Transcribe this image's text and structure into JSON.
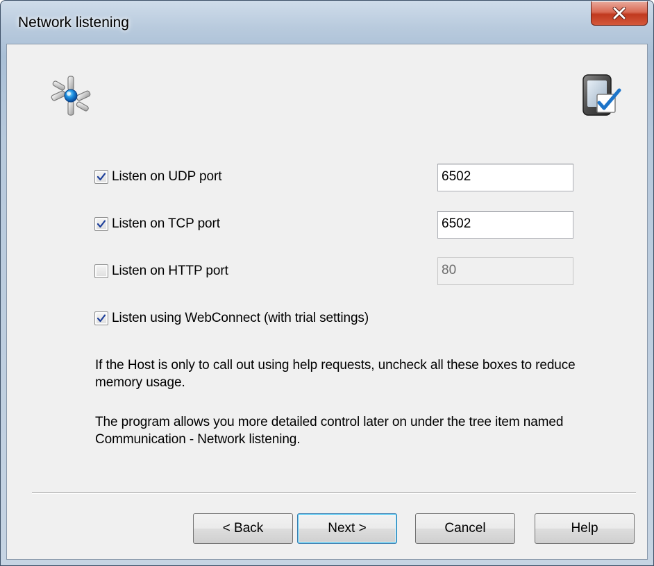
{
  "window": {
    "title": "Network listening",
    "close_glyph": "X"
  },
  "icons": {
    "header_left": "network-hub-icon",
    "header_right": "device-checkmark-icon",
    "close": "close-icon",
    "check": "checkmark-icon"
  },
  "colors": {
    "accent": "#1c74c9",
    "close_button": "#c7432a"
  },
  "options": [
    {
      "label": "Listen on UDP port",
      "checked": true,
      "port": "6502",
      "port_enabled": true
    },
    {
      "label": "Listen on TCP port",
      "checked": true,
      "port": "6502",
      "port_enabled": true
    },
    {
      "label": "Listen on HTTP port",
      "checked": false,
      "port": "80",
      "port_enabled": false
    },
    {
      "label": "Listen using WebConnect (with trial settings)",
      "checked": true
    }
  ],
  "info": {
    "paragraph1": "If the Host is only to call out using help requests, uncheck all these boxes to reduce memory usage.",
    "paragraph2": "The program allows you more detailed control later on under the tree item named Communication - Network listening."
  },
  "buttons": {
    "back": "< Back",
    "next": "Next >",
    "cancel": "Cancel",
    "help": "Help"
  }
}
